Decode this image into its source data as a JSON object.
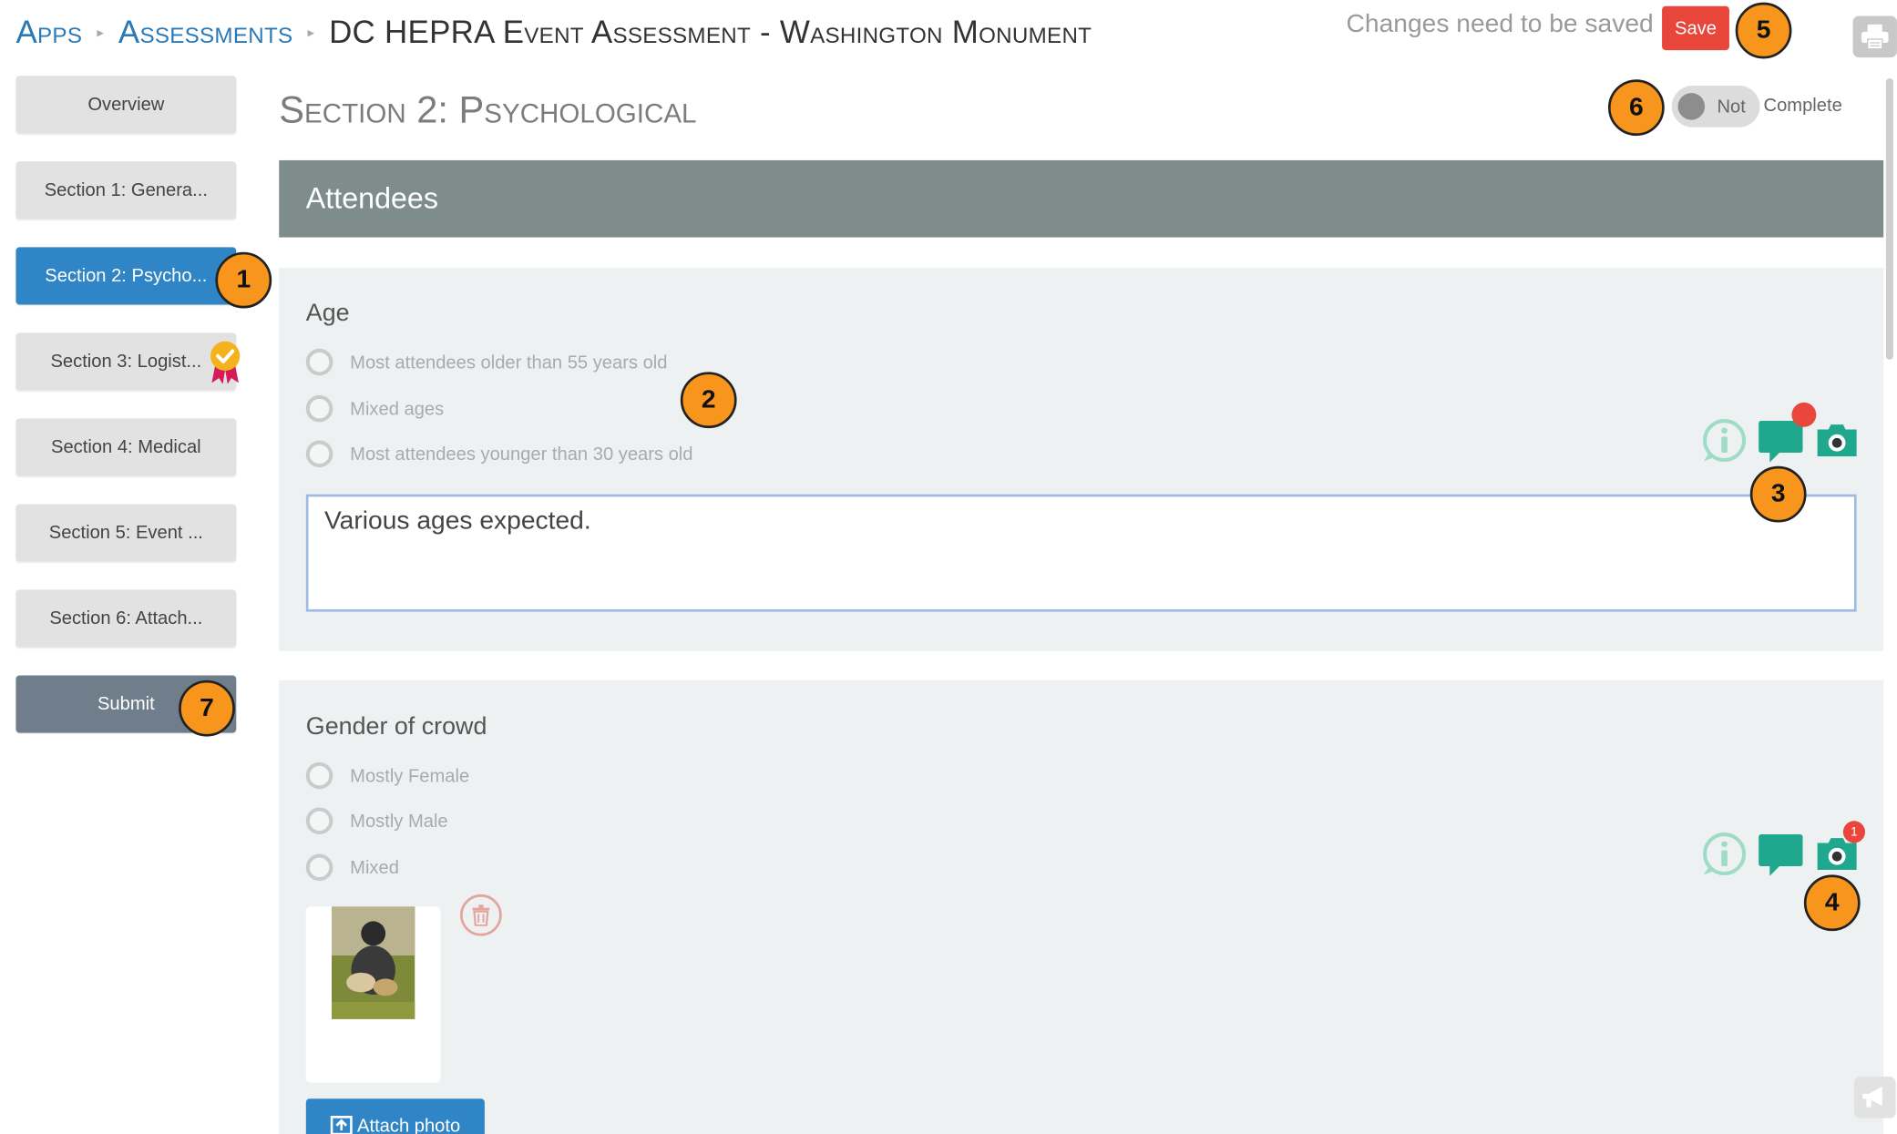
{
  "breadcrumb": {
    "apps": "Apps",
    "assessments": "Assessments",
    "current": "DC HEPRA Event Assessment - Washington Monument"
  },
  "header": {
    "save_status": "Changes need to be saved",
    "save_label": "Save",
    "print_icon": "printer-icon"
  },
  "sidebar": {
    "items": [
      {
        "label": "Overview"
      },
      {
        "label": "Section 1: Genera..."
      },
      {
        "label": "Section 2: Psycho...",
        "active": true
      },
      {
        "label": "Section 3: Logist...",
        "badge": "award-check-icon"
      },
      {
        "label": "Section 4: Medical"
      },
      {
        "label": "Section 5: Event ..."
      },
      {
        "label": "Section 6: Attach..."
      }
    ],
    "submit_label": "Submit"
  },
  "main": {
    "section_title": "Section 2: Psychological",
    "toggle": {
      "state_label": "Not",
      "label": "Complete",
      "on": false
    },
    "panel_title": "Attendees",
    "questions": [
      {
        "label": "Age",
        "options": [
          "Most attendees older than 55 years old",
          "Mixed ages",
          "Most attendees younger than 30 years old"
        ],
        "notes": "Various ages expected.",
        "icons": {
          "info": "info-icon",
          "comment": "comment-icon",
          "camera": "camera-icon"
        },
        "comment_has_note": true
      },
      {
        "label": "Gender of crowd",
        "options": [
          "Mostly Female",
          "Mostly Male",
          "Mixed"
        ],
        "icons": {
          "info": "info-icon",
          "comment": "comment-icon",
          "camera": "camera-icon"
        },
        "photo_count": "1",
        "attach_label": "Attach photo"
      }
    ]
  },
  "callouts": [
    "1",
    "2",
    "3",
    "4",
    "5",
    "6",
    "7"
  ],
  "colors": {
    "accent_blue": "#2f85c5",
    "save_red": "#e8463a",
    "teal_icon": "#1fa88e",
    "panel_header": "#7f8c8c",
    "callout_orange": "#f7951d"
  }
}
